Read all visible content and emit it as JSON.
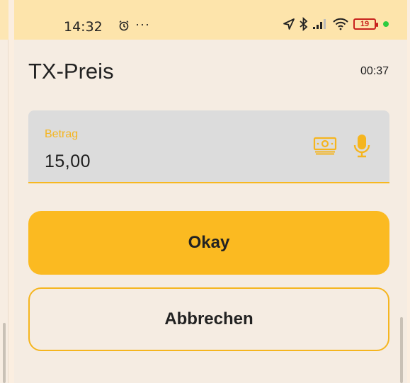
{
  "status_bar": {
    "time": "14:32",
    "dots": "···",
    "battery_level": "19",
    "icons": [
      "alarm-icon",
      "navigation-icon",
      "bluetooth-icon",
      "signal-icon",
      "wifi-icon",
      "battery-icon",
      "status-dot-icon"
    ]
  },
  "dialog": {
    "title": "TX-Preis",
    "timer": "00:37"
  },
  "amount_field": {
    "label": "Betrag",
    "value": "15,00"
  },
  "buttons": {
    "okay": "Okay",
    "cancel": "Abbrechen"
  },
  "colors": {
    "accent": "#fbba21",
    "status_bar_bg": "#fde4ab",
    "dialog_bg": "#f5ece2",
    "field_bg": "#dcdcdc",
    "battery_low": "#c8231e",
    "status_dot": "#2ecc40"
  }
}
